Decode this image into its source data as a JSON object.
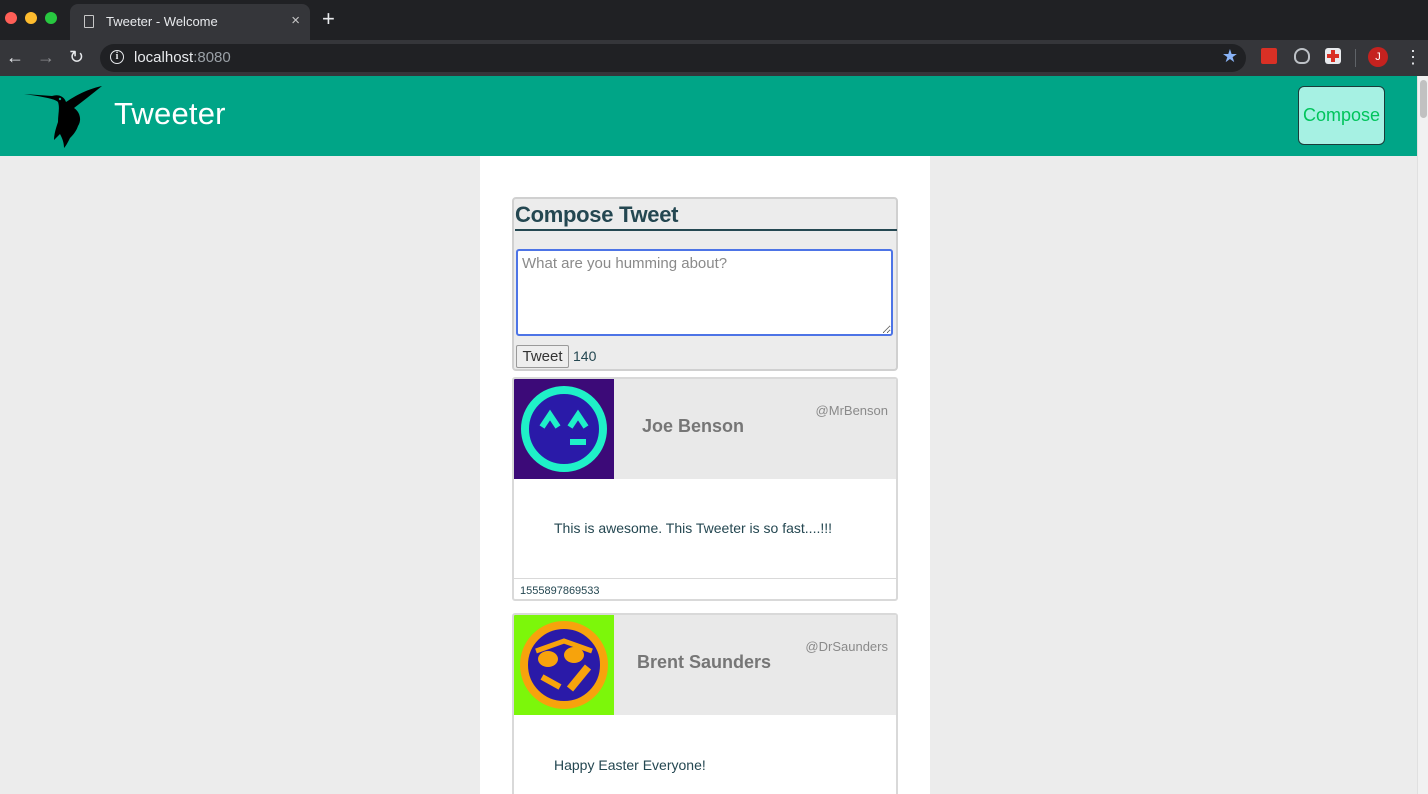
{
  "browser": {
    "tab_title": "Tweeter - Welcome",
    "tab_close": "×",
    "new_tab": "+",
    "url_host": "localhost",
    "url_port": ":8080",
    "info_glyph": "i",
    "star_glyph": "★",
    "profile_initial": "J",
    "menu_glyph": "⋮",
    "back_glyph": "←",
    "forward_glyph": "→",
    "reload_glyph": "↻"
  },
  "header": {
    "brand": "Tweeter",
    "compose_button": "Compose",
    "brand_color": "#00a587"
  },
  "compose": {
    "title": "Compose Tweet",
    "placeholder": "What are you humming about?",
    "submit_label": "Tweet",
    "char_count": "140"
  },
  "tweets": [
    {
      "name": "Joe Benson",
      "handle": "@MrBenson",
      "body": "This is awesome. This Tweeter is so fast....!!!",
      "timestamp": "1555897869533",
      "avatar_icon": "emoji-face-avatar"
    },
    {
      "name": "Brent Saunders",
      "handle": "@DrSaunders",
      "body": "Happy Easter Everyone!",
      "avatar_icon": "sunglasses-face-avatar"
    }
  ]
}
